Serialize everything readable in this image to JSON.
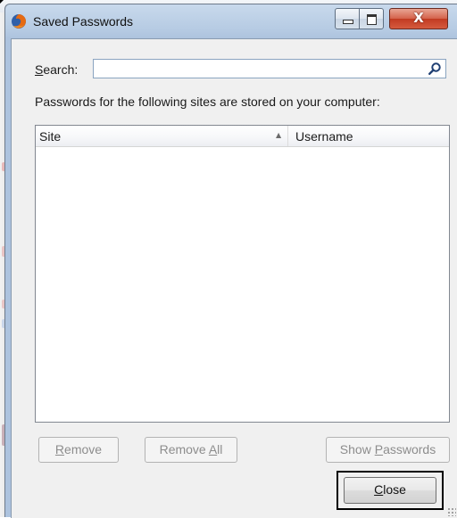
{
  "window": {
    "title": "Saved Passwords",
    "icon": "firefox-icon",
    "controls": {
      "minimize": "minimize-icon",
      "maximize": "maximize-icon",
      "close": "X"
    }
  },
  "search": {
    "label_prefix": "",
    "label_access_key": "S",
    "label_rest": "earch:",
    "value": "",
    "placeholder": "",
    "icon": "search-icon"
  },
  "info_text": "Passwords for the following sites are stored on your computer:",
  "table": {
    "columns": [
      {
        "label": "Site",
        "sorted": "ascending"
      },
      {
        "label": "Username"
      }
    ],
    "rows": []
  },
  "buttons": {
    "remove": {
      "prefix": "",
      "access_key": "R",
      "rest": "emove",
      "enabled": false
    },
    "remove_all": {
      "prefix": "Remove ",
      "access_key": "A",
      "rest": "ll",
      "enabled": false
    },
    "show_passwords": {
      "prefix": "Show ",
      "access_key": "P",
      "rest": "asswords",
      "enabled": false
    },
    "close": {
      "prefix": "",
      "access_key": "C",
      "rest": "lose",
      "enabled": true,
      "focused": true
    }
  },
  "colors": {
    "title_bar": "#b6cbe3",
    "dialog_bg": "#f0f0f0",
    "close_control": "#c23b22",
    "disabled_text": "#8d8d8d"
  }
}
